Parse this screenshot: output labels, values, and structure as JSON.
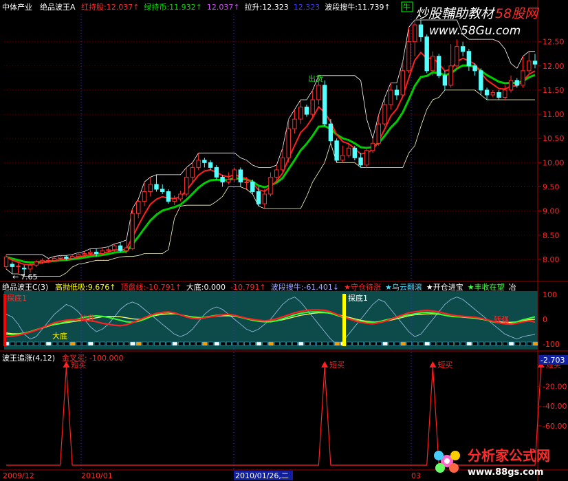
{
  "main_panel": {
    "header": {
      "sector": "中体产业",
      "indicator": "绝品波王A",
      "items": [
        {
          "label": "红持股:",
          "value": "12.037",
          "arrow": "↑",
          "color": "#ff2a2a"
        },
        {
          "label": "绿持币:",
          "value": "11.932",
          "arrow": "↑",
          "color": "#00e000"
        },
        {
          "label": "",
          "value": "12.037",
          "arrow": "↑",
          "color": "#d24dff"
        },
        {
          "label": "拉升:",
          "value": "12.323",
          "arrow": "",
          "color": "#ffffff"
        },
        {
          "label": "",
          "value": "12.323",
          "arrow": "",
          "color": "#3a3aff"
        },
        {
          "label": "波段搜牛:",
          "value": "11.739",
          "arrow": "↑",
          "color": "#ffffff"
        }
      ],
      "tag": "牛"
    },
    "watermark": {
      "text1": "炒股輔助教材",
      "text2": "58股网",
      "url": "www.58Gu.com"
    },
    "annotations": {
      "sell": "出货",
      "low_price": "7.65"
    },
    "y_ticks": [
      "12.50",
      "12.00",
      "11.50",
      "11.00",
      "10.50",
      "10.00",
      "9.50",
      "9.00",
      "8.50",
      "8.00"
    ]
  },
  "osc_panel": {
    "header": {
      "title": "绝品波王C(3)",
      "items": [
        {
          "label": "高抛低吸:",
          "value": "9.676",
          "arrow": "↑",
          "color": "#ffff00"
        },
        {
          "label": "顶盘线:",
          "value": "-10.791",
          "arrow": "↑",
          "color": "#ff2a2a"
        },
        {
          "label": "大底:",
          "value": "0.000",
          "arrow": "",
          "color": "#ffffff"
        },
        {
          "label": "",
          "value": "-10.791",
          "arrow": "↑",
          "color": "#ff2a2a"
        },
        {
          "label": "波段搜牛:",
          "value": "-61.401",
          "arrow": "↓",
          "color": "#9fa8ff"
        }
      ],
      "stars": [
        {
          "text": "★守仓待涨",
          "color": "#ff2a2a"
        },
        {
          "text": "★乌云翻滚",
          "color": "#44ddff"
        },
        {
          "text": "★开仓进宝",
          "color": "#ffffff"
        },
        {
          "text": "★丰收在望",
          "color": "#44ff44"
        },
        {
          "text": "冶",
          "color": "#ffffff"
        }
      ]
    },
    "labels": {
      "top_left": "探底1",
      "bigbottom": "大底",
      "up": "拉升",
      "probe": "探底1",
      "turn": "转强"
    },
    "y_ticks": [
      "100",
      "0",
      "-100"
    ]
  },
  "bottom_panel": {
    "header": {
      "title": "波王追涨(4,12)",
      "label": "金叉买:",
      "value": "-100.000",
      "color": "#ff2a2a"
    },
    "current_value": "-2.703",
    "buy_label": "短买",
    "y_ticks": [
      "-20.00",
      "-40.00",
      "-60.00"
    ],
    "x_labels": [
      "2009/12",
      "2010/01",
      "2010/01/26,二",
      "03"
    ],
    "watermark": {
      "text": "分析家公式网",
      "url": "www.88gs.com"
    }
  },
  "chart_data": {
    "type": "candlestick",
    "candles": [
      {
        "o": 7.85,
        "c": 8.05,
        "h": 8.1,
        "l": 7.8
      },
      {
        "o": 7.9,
        "c": 7.85,
        "h": 7.95,
        "l": 7.7
      },
      {
        "o": 7.85,
        "c": 7.86,
        "h": 7.92,
        "l": 7.7
      },
      {
        "o": 7.82,
        "c": 7.8,
        "h": 7.88,
        "l": 7.65
      },
      {
        "o": 7.8,
        "c": 7.88,
        "h": 7.92,
        "l": 7.72
      },
      {
        "o": 7.88,
        "c": 7.95,
        "h": 7.98,
        "l": 7.84
      },
      {
        "o": 7.95,
        "c": 7.98,
        "h": 8.02,
        "l": 7.9
      },
      {
        "o": 7.98,
        "c": 7.98,
        "h": 8.02,
        "l": 7.92
      },
      {
        "o": 7.98,
        "c": 8.02,
        "h": 8.06,
        "l": 7.95
      },
      {
        "o": 8.02,
        "c": 8.05,
        "h": 8.08,
        "l": 7.98
      },
      {
        "o": 8.05,
        "c": 8.02,
        "h": 8.08,
        "l": 7.98
      },
      {
        "o": 8.02,
        "c": 8.06,
        "h": 8.1,
        "l": 7.98
      },
      {
        "o": 8.06,
        "c": 8.1,
        "h": 8.14,
        "l": 8.02
      },
      {
        "o": 8.1,
        "c": 8.12,
        "h": 8.16,
        "l": 8.05
      },
      {
        "o": 8.12,
        "c": 8.15,
        "h": 8.22,
        "l": 8.08
      },
      {
        "o": 8.15,
        "c": 8.12,
        "h": 8.22,
        "l": 8.06
      },
      {
        "o": 8.12,
        "c": 8.18,
        "h": 8.24,
        "l": 8.08
      },
      {
        "o": 8.18,
        "c": 8.2,
        "h": 8.26,
        "l": 8.14
      },
      {
        "o": 8.2,
        "c": 8.28,
        "h": 8.32,
        "l": 8.16
      },
      {
        "o": 8.28,
        "c": 8.18,
        "h": 8.35,
        "l": 8.15
      },
      {
        "o": 8.18,
        "c": 8.24,
        "h": 8.4,
        "l": 8.12
      },
      {
        "o": 8.22,
        "c": 8.95,
        "h": 9.05,
        "l": 8.2
      },
      {
        "o": 8.95,
        "c": 9.2,
        "h": 9.25,
        "l": 8.85
      },
      {
        "o": 9.2,
        "c": 9.4,
        "h": 9.6,
        "l": 9.1
      },
      {
        "o": 9.4,
        "c": 9.55,
        "h": 9.7,
        "l": 9.3
      },
      {
        "o": 9.55,
        "c": 9.45,
        "h": 9.75,
        "l": 9.4
      },
      {
        "o": 9.45,
        "c": 9.4,
        "h": 9.55,
        "l": 9.35
      },
      {
        "o": 9.4,
        "c": 9.2,
        "h": 9.45,
        "l": 9.15
      },
      {
        "o": 9.2,
        "c": 9.25,
        "h": 9.32,
        "l": 9.12
      },
      {
        "o": 9.25,
        "c": 9.35,
        "h": 9.42,
        "l": 9.2
      },
      {
        "o": 9.35,
        "c": 9.7,
        "h": 9.9,
        "l": 9.3
      },
      {
        "o": 9.7,
        "c": 9.9,
        "h": 10.0,
        "l": 9.6
      },
      {
        "o": 9.9,
        "c": 10.05,
        "h": 10.2,
        "l": 9.85
      },
      {
        "o": 10.05,
        "c": 10.0,
        "h": 10.1,
        "l": 9.9
      },
      {
        "o": 10.0,
        "c": 9.9,
        "h": 10.05,
        "l": 9.85
      },
      {
        "o": 9.9,
        "c": 9.7,
        "h": 9.95,
        "l": 9.65
      },
      {
        "o": 9.7,
        "c": 9.6,
        "h": 9.75,
        "l": 9.5
      },
      {
        "o": 9.6,
        "c": 9.65,
        "h": 9.8,
        "l": 9.55
      },
      {
        "o": 9.65,
        "c": 9.85,
        "h": 9.9,
        "l": 9.6
      },
      {
        "o": 9.85,
        "c": 9.6,
        "h": 9.9,
        "l": 9.5
      },
      {
        "o": 9.6,
        "c": 9.6,
        "h": 9.7,
        "l": 9.45
      },
      {
        "o": 9.6,
        "c": 9.4,
        "h": 9.65,
        "l": 9.35
      },
      {
        "o": 9.4,
        "c": 9.15,
        "h": 9.5,
        "l": 9.1
      },
      {
        "o": 9.15,
        "c": 9.35,
        "h": 9.45,
        "l": 9.05
      },
      {
        "o": 9.35,
        "c": 9.7,
        "h": 9.8,
        "l": 9.3
      },
      {
        "o": 9.7,
        "c": 9.85,
        "h": 9.95,
        "l": 9.6
      },
      {
        "o": 9.85,
        "c": 10.1,
        "h": 10.3,
        "l": 9.8
      },
      {
        "o": 10.1,
        "c": 10.7,
        "h": 10.9,
        "l": 10.0
      },
      {
        "o": 10.7,
        "c": 10.9,
        "h": 11.1,
        "l": 10.6
      },
      {
        "o": 10.9,
        "c": 11.15,
        "h": 11.3,
        "l": 10.8
      },
      {
        "o": 11.15,
        "c": 11.0,
        "h": 11.2,
        "l": 10.95
      },
      {
        "o": 11.0,
        "c": 11.3,
        "h": 11.5,
        "l": 10.95
      },
      {
        "o": 11.3,
        "c": 11.6,
        "h": 11.8,
        "l": 11.2
      },
      {
        "o": 11.6,
        "c": 10.8,
        "h": 11.7,
        "l": 10.75
      },
      {
        "o": 10.8,
        "c": 10.45,
        "h": 10.9,
        "l": 10.4
      },
      {
        "o": 10.45,
        "c": 10.05,
        "h": 10.5,
        "l": 10.0
      },
      {
        "o": 10.05,
        "c": 10.15,
        "h": 10.35,
        "l": 10.0
      },
      {
        "o": 10.15,
        "c": 10.3,
        "h": 10.4,
        "l": 10.1
      },
      {
        "o": 10.3,
        "c": 10.1,
        "h": 10.35,
        "l": 10.05
      },
      {
        "o": 10.1,
        "c": 9.95,
        "h": 10.2,
        "l": 9.9
      },
      {
        "o": 9.95,
        "c": 10.25,
        "h": 10.3,
        "l": 9.9
      },
      {
        "o": 10.25,
        "c": 10.4,
        "h": 10.5,
        "l": 10.2
      },
      {
        "o": 10.4,
        "c": 10.8,
        "h": 11.0,
        "l": 10.35
      },
      {
        "o": 10.8,
        "c": 11.2,
        "h": 11.35,
        "l": 10.75
      },
      {
        "o": 11.2,
        "c": 11.5,
        "h": 11.65,
        "l": 11.1
      },
      {
        "o": 11.5,
        "c": 11.4,
        "h": 11.6,
        "l": 11.3
      },
      {
        "o": 11.4,
        "c": 11.9,
        "h": 12.1,
        "l": 11.35
      },
      {
        "o": 11.9,
        "c": 12.5,
        "h": 12.8,
        "l": 11.85
      },
      {
        "o": 12.5,
        "c": 12.85,
        "h": 12.95,
        "l": 12.2
      },
      {
        "o": 12.85,
        "c": 12.6,
        "h": 12.95,
        "l": 12.5
      },
      {
        "o": 12.6,
        "c": 11.9,
        "h": 12.65,
        "l": 11.85
      },
      {
        "o": 11.9,
        "c": 12.2,
        "h": 12.3,
        "l": 11.8
      },
      {
        "o": 12.2,
        "c": 11.8,
        "h": 12.25,
        "l": 11.75
      },
      {
        "o": 11.8,
        "c": 11.6,
        "h": 11.9,
        "l": 11.5
      },
      {
        "o": 11.6,
        "c": 12.0,
        "h": 12.45,
        "l": 11.55
      },
      {
        "o": 12.0,
        "c": 12.4,
        "h": 12.55,
        "l": 11.95
      },
      {
        "o": 12.4,
        "c": 12.3,
        "h": 12.5,
        "l": 12.2
      },
      {
        "o": 12.3,
        "c": 12.0,
        "h": 12.35,
        "l": 11.9
      },
      {
        "o": 12.0,
        "c": 11.9,
        "h": 12.05,
        "l": 11.8
      },
      {
        "o": 11.9,
        "c": 11.5,
        "h": 11.95,
        "l": 11.4
      },
      {
        "o": 11.5,
        "c": 11.4,
        "h": 11.55,
        "l": 11.3
      },
      {
        "o": 11.4,
        "c": 11.45,
        "h": 11.5,
        "l": 11.35
      },
      {
        "o": 11.45,
        "c": 11.35,
        "h": 11.5,
        "l": 11.3
      },
      {
        "o": 11.35,
        "c": 11.5,
        "h": 11.6,
        "l": 11.3
      },
      {
        "o": 11.5,
        "c": 11.7,
        "h": 11.8,
        "l": 11.45
      },
      {
        "o": 11.7,
        "c": 11.6,
        "h": 11.75,
        "l": 11.55
      },
      {
        "o": 11.6,
        "c": 11.9,
        "h": 12.2,
        "l": 11.55
      },
      {
        "o": 11.9,
        "c": 12.1,
        "h": 12.3,
        "l": 11.85
      },
      {
        "o": 12.1,
        "c": 12.037,
        "h": 12.25,
        "l": 11.95
      }
    ],
    "osc_red": [
      -70,
      -68,
      -64,
      -58,
      -52,
      -44,
      -34,
      -24,
      -14,
      -8,
      -4,
      -2,
      0,
      -2,
      -6,
      -10,
      -16,
      -20,
      -24,
      -26,
      -22,
      -14,
      -4,
      6,
      16,
      24,
      28,
      30,
      26,
      18,
      10,
      4,
      2,
      6,
      10,
      14,
      18,
      20,
      16,
      10,
      4,
      0,
      -4,
      -6,
      -4,
      2,
      10,
      18,
      26,
      32,
      36,
      38,
      38,
      36,
      30,
      20,
      10,
      2,
      -6,
      -12,
      -16,
      -18,
      -14,
      -8,
      0,
      10,
      18,
      26,
      30,
      34,
      36,
      34,
      30,
      24,
      18,
      14,
      12,
      10,
      8,
      4,
      -2,
      -8,
      -14,
      -18,
      -20,
      -16,
      -10,
      -6,
      -10.791
    ],
    "osc_green": [
      -60,
      -62,
      -60,
      -56,
      -50,
      -42,
      -34,
      -26,
      -20,
      -16,
      -10,
      -4,
      2,
      8,
      12,
      14,
      12,
      8,
      2,
      -4,
      -10,
      -12,
      -8,
      0,
      10,
      20,
      26,
      28,
      24,
      18,
      12,
      8,
      6,
      8,
      12,
      16,
      18,
      18,
      14,
      8,
      2,
      -4,
      -8,
      -10,
      -10,
      -6,
      2,
      10,
      18,
      24,
      28,
      30,
      30,
      28,
      24,
      16,
      8,
      2,
      -4,
      -8,
      -12,
      -12,
      -10,
      -4,
      2,
      8,
      14,
      18,
      22,
      26,
      28,
      26,
      22,
      16,
      12,
      10,
      10,
      8,
      6,
      2,
      -4,
      -10,
      -14,
      -18,
      -16,
      -10,
      -2,
      4,
      9.676
    ],
    "osc_yellow": [
      -55,
      -58,
      -58,
      -55,
      -50,
      -44,
      -36,
      -28,
      -22,
      -18,
      -14,
      -10,
      -6,
      -2,
      2,
      6,
      10,
      12,
      12,
      10,
      6,
      2,
      0,
      4,
      10,
      16,
      20,
      22,
      22,
      18,
      14,
      10,
      8,
      8,
      10,
      12,
      14,
      14,
      12,
      8,
      4,
      0,
      -4,
      -6,
      -8,
      -6,
      -2,
      4,
      10,
      16,
      20,
      24,
      26,
      26,
      24,
      20,
      14,
      8,
      2,
      -4,
      -8,
      -10,
      -10,
      -8,
      -4,
      2,
      8,
      14,
      18,
      20,
      22,
      22,
      20,
      16,
      12,
      10,
      8,
      6,
      4,
      0,
      -4,
      -8,
      -10,
      -12,
      -12,
      -10,
      -6,
      -2,
      0
    ],
    "osc_blue": [
      20,
      10,
      -20,
      -60,
      -80,
      -70,
      -40,
      -10,
      20,
      40,
      60,
      50,
      30,
      0,
      -30,
      -50,
      -40,
      -20,
      10,
      40,
      60,
      70,
      60,
      40,
      20,
      0,
      -20,
      -40,
      -60,
      -70,
      -60,
      -40,
      -10,
      20,
      40,
      50,
      40,
      20,
      0,
      -20,
      -40,
      -50,
      -40,
      -20,
      0,
      30,
      60,
      80,
      90,
      70,
      40,
      10,
      -20,
      -50,
      -80,
      -100,
      -90,
      -60,
      -30,
      0,
      30,
      60,
      80,
      70,
      40,
      10,
      -20,
      -50,
      -70,
      -60,
      -30,
      0,
      30,
      60,
      80,
      90,
      80,
      60,
      40,
      20,
      0,
      -20,
      -40,
      -60,
      -70,
      -80,
      -70,
      -65,
      -61.401
    ],
    "short_buy_index": [
      10,
      53,
      71,
      89
    ]
  }
}
